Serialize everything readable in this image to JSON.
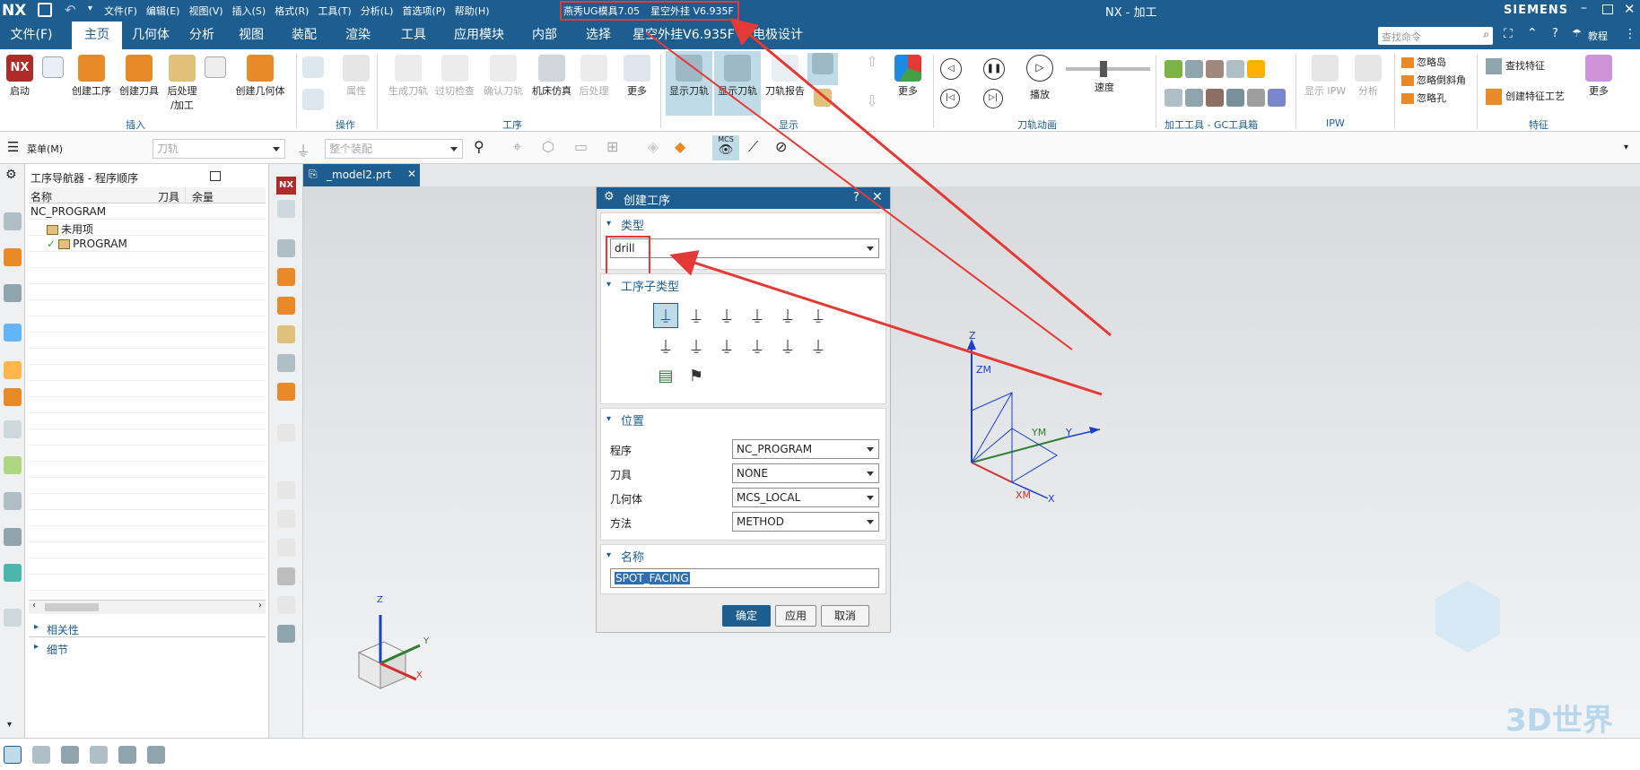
{
  "titlebar": {
    "logo": "NX",
    "menus": [
      "文件(F)",
      "编辑(E)",
      "视图(V)",
      "插入(S)",
      "格式(R)",
      "工具(T)",
      "分析(L)",
      "首选项(P)",
      "帮助(H)"
    ],
    "plugin1": "燕秀UG模具7.05",
    "plugin2": "星空外挂 V6.935F",
    "app_title": "NX - 加工",
    "brand": "SIEMENS"
  },
  "ribbon_tabs": [
    "文件(F)",
    "主页",
    "几何体",
    "分析",
    "视图",
    "装配",
    "渲染",
    "工具",
    "应用模块",
    "内部",
    "选择",
    "星空外挂V6.935F",
    "电极设计"
  ],
  "search_placeholder": "查找命令",
  "tutorial_label": "教程",
  "ribbon": {
    "home": {
      "launch": "启动",
      "create_op": "创建工序",
      "create_tool": "创建刀具",
      "postprocess": "后处理",
      "postprocess2": "/加工",
      "create_geom": "创建几何体",
      "insert_group": "插入",
      "attr": "属性",
      "ops_group": "操作",
      "gen_path": "生成刀轨",
      "check": "过切检查",
      "confirm": "确认刀轨",
      "sim": "机床仿真",
      "post": "后处理",
      "more1": "更多",
      "proc_group": "工序",
      "show_path": "显示刀轨",
      "show_tool": "显示刀轨",
      "report": "刀轨报告",
      "more2": "更多",
      "display_group": "显示",
      "play": "播放",
      "speed": "速度",
      "anim_group": "刀轨动画",
      "gc_group": "加工工具 - GC工具箱",
      "show_ipw": "显示 IPW",
      "analyze": "分析",
      "ipw_group": "IPW",
      "ignore_pocket": "忽略岛",
      "ignore_chamfer": "忽略倒斜角",
      "ignore_hole": "忽略孔",
      "find_feature": "查找特征",
      "create_feature_proc": "创建特征工艺",
      "more3": "更多",
      "feature_group": "特征"
    }
  },
  "toolbar2": {
    "menu_label": "菜单(M)",
    "filter1": "刀轨",
    "filter2": "整个装配",
    "mcs": "MCS"
  },
  "navigator": {
    "title": "工序导航器 - 程序顺序",
    "columns": [
      "名称",
      "刀具",
      "余量"
    ],
    "rows": [
      {
        "name": "NC_PROGRAM"
      },
      {
        "name": "未用项"
      },
      {
        "name": "PROGRAM"
      }
    ],
    "footer1": "相关性",
    "footer2": "细节"
  },
  "doc_tab": "_model2.prt",
  "dialog": {
    "title": "创建工序",
    "type_header": "类型",
    "type_value": "drill",
    "subtype_header": "工序子类型",
    "location_header": "位置",
    "program_label": "程序",
    "program_value": "NC_PROGRAM",
    "tool_label": "刀具",
    "tool_value": "NONE",
    "geometry_label": "几何体",
    "geometry_value": "MCS_LOCAL",
    "method_label": "方法",
    "method_value": "METHOD",
    "name_header": "名称",
    "name_value": "SPOT_FACING",
    "ok": "确定",
    "apply": "应用",
    "cancel": "取消"
  },
  "axes": {
    "z": "Z",
    "zm": "ZM",
    "ym": "YM",
    "y": "Y",
    "xm": "XM",
    "x": "X"
  },
  "watermark": "3D世界网",
  "colors": {
    "theme": "#1e5d8f",
    "annotation": "#e53935"
  }
}
